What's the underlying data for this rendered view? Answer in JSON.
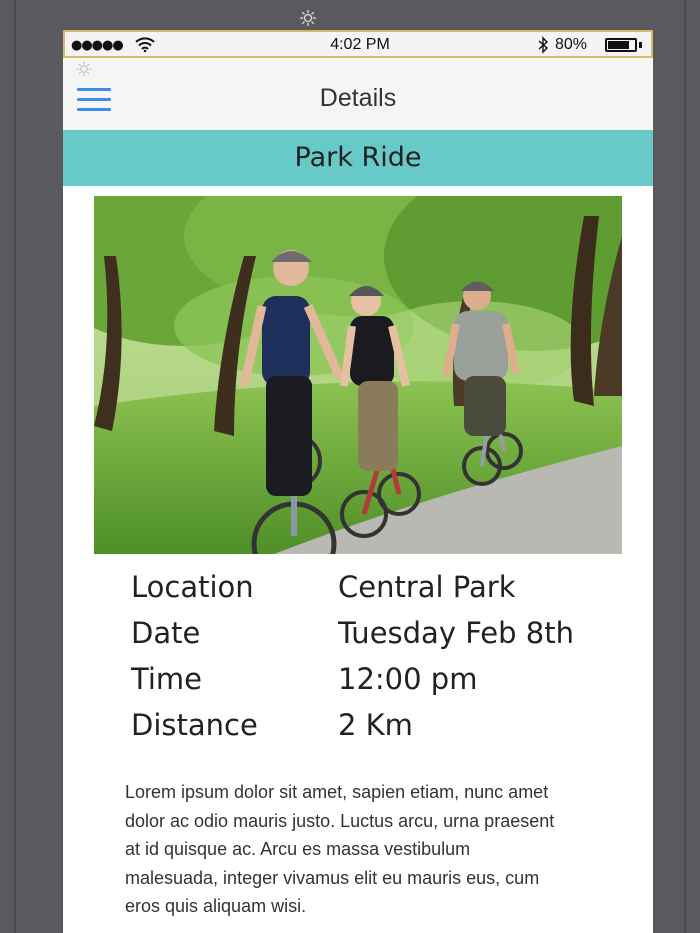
{
  "status_bar": {
    "signal": "●●●●●",
    "time": "4:02 PM",
    "battery_percent": "80%",
    "battery_level": 0.8
  },
  "icons": {
    "settings": "gear-icon",
    "menu": "hamburger-menu-icon",
    "wifi": "wifi-icon",
    "bluetooth": "bluetooth-icon",
    "battery": "battery-icon"
  },
  "navbar": {
    "title": "Details"
  },
  "event": {
    "title": "Park Ride",
    "photo_subject": "three cyclists riding bicycles on a park path under green trees",
    "details": [
      {
        "label": "Location",
        "value": "Central Park"
      },
      {
        "label": "Date",
        "value": "Tuesday Feb 8th"
      },
      {
        "label": "Time",
        "value": "12:00 pm"
      },
      {
        "label": "Distance",
        "value": "2 Km"
      }
    ],
    "description": "Lorem ipsum dolor sit amet, sapien etiam, nunc amet dolor ac odio mauris justo. Luctus arcu, urna praesent at id quisque ac. Arcu es massa vestibulum malesuada, integer vivamus elit eu mauris eus, cum eros quis aliquam wisi."
  },
  "colors": {
    "banner": "#67cac9",
    "menu_accent": "#3a8ee6",
    "frame": "#5a5a5e",
    "status_border": "#d9b86a"
  }
}
